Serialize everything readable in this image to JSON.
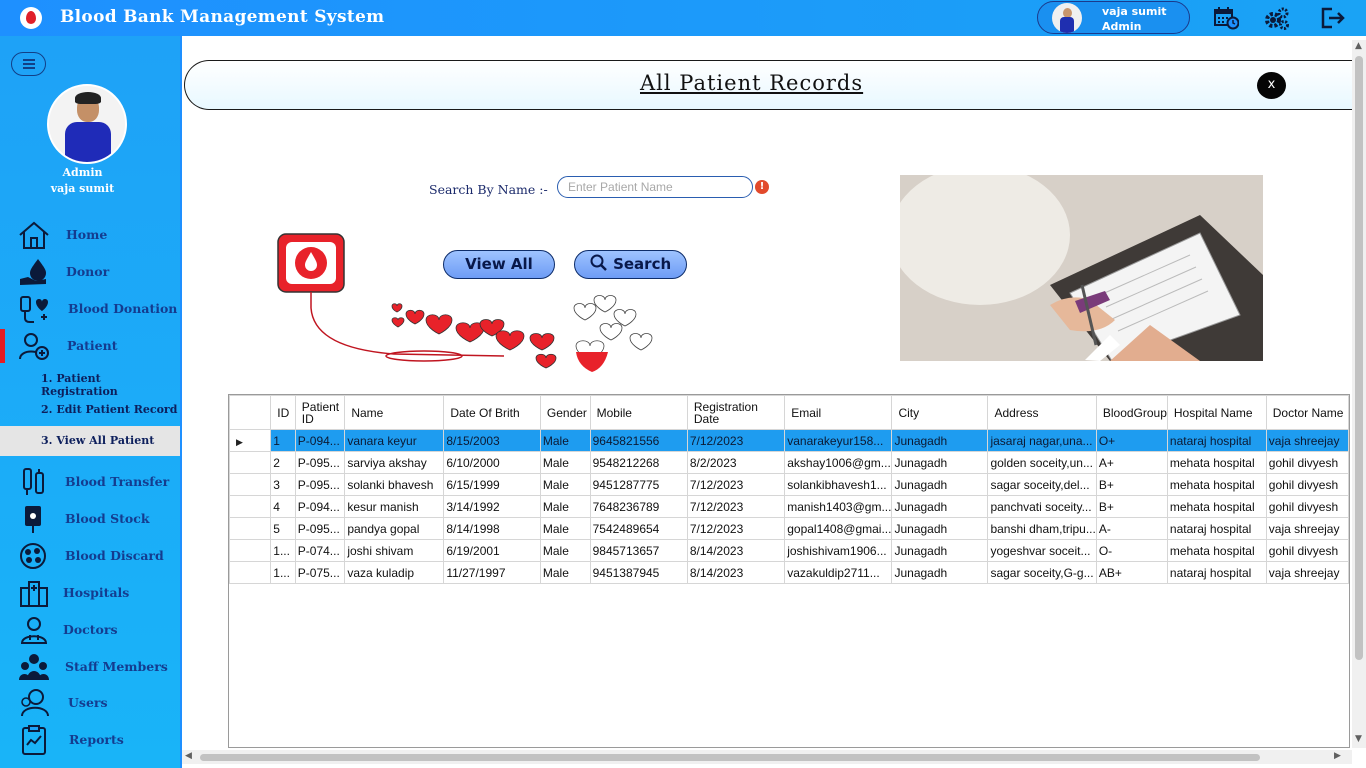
{
  "app": {
    "title": "Blood Bank Management System"
  },
  "user": {
    "name": "vaja sumit",
    "role": "Admin"
  },
  "sidebar": {
    "profile_role": "Admin",
    "profile_name": "vaja sumit",
    "items": [
      {
        "label": "Home",
        "icon": "home-icon"
      },
      {
        "label": "Donor",
        "icon": "donor-icon"
      },
      {
        "label": "Blood Donation",
        "icon": "blood-donation-icon"
      },
      {
        "label": "Patient",
        "icon": "patient-icon"
      },
      {
        "label": "Blood Transfer",
        "icon": "blood-transfer-icon"
      },
      {
        "label": "Blood Stock",
        "icon": "blood-stock-icon"
      },
      {
        "label": "Blood Discard",
        "icon": "blood-discard-icon"
      },
      {
        "label": "Hospitals",
        "icon": "hospital-icon"
      },
      {
        "label": "Doctors",
        "icon": "doctor-icon"
      },
      {
        "label": "Staff Members",
        "icon": "staff-icon"
      },
      {
        "label": "Users",
        "icon": "users-icon"
      },
      {
        "label": "Reports",
        "icon": "reports-icon"
      }
    ],
    "patient_sub": [
      "1.  Patient Registration",
      "2.  Edit Patient Record",
      "3.  View All Patient"
    ]
  },
  "page": {
    "title": "All Patient Records",
    "close_label": "x",
    "search_label": "Search By Name  :-",
    "search_placeholder": "Enter Patient Name",
    "search_value": "",
    "view_all_label": "View All",
    "search_button_label": "Search",
    "warn_glyph": "!"
  },
  "table": {
    "columns": [
      "ID",
      "Patient ID",
      "Name",
      "Date Of Brith",
      "Gender",
      "Mobile",
      "Registration Date",
      "Email",
      "City",
      "Address",
      "BloodGroup",
      "Hospital Name",
      "Doctor Name"
    ],
    "rows": [
      [
        "1",
        "P-094...",
        "vanara keyur",
        "8/15/2003",
        "Male",
        "9645821556",
        "7/12/2023",
        "vanarakeyur158...",
        "Junagadh",
        "jasaraj nagar,una...",
        "O+",
        "nataraj hospital",
        "vaja shreejay"
      ],
      [
        "2",
        "P-095...",
        "sarviya akshay",
        "6/10/2000",
        "Male",
        "9548212268",
        "8/2/2023",
        "akshay1006@gm...",
        "Junagadh",
        "golden soceity,un...",
        "A+",
        "mehata hospital",
        "gohil divyesh"
      ],
      [
        "3",
        "P-095...",
        "solanki bhavesh",
        "6/15/1999",
        "Male",
        "9451287775",
        "7/12/2023",
        "solankibhavesh1...",
        "Junagadh",
        "sagar soceity,del...",
        "B+",
        "mehata hospital",
        "gohil divyesh"
      ],
      [
        "4",
        "P-094...",
        "kesur manish",
        "3/14/1992",
        "Male",
        "7648236789",
        "7/12/2023",
        "manish1403@gm...",
        "Junagadh",
        "panchvati soceity...",
        "B+",
        "mehata hospital",
        "gohil divyesh"
      ],
      [
        "5",
        "P-095...",
        "pandya gopal",
        "8/14/1998",
        "Male",
        "7542489654",
        "7/12/2023",
        "gopal1408@gmai...",
        "Junagadh",
        "banshi dham,tripu...",
        "A-",
        "nataraj hospital",
        "vaja shreejay"
      ],
      [
        "1...",
        "P-074...",
        "joshi shivam",
        "6/19/2001",
        "Male",
        "9845713657",
        "8/14/2023",
        "joshishivam1906...",
        "Junagadh",
        "yogeshvar soceit...",
        "O-",
        "mehata hospital",
        "gohil divyesh"
      ],
      [
        "1...",
        "P-075...",
        "vaza kuladip",
        "11/27/1997",
        "Male",
        "9451387945",
        "8/14/2023",
        "vazakuldip2711...",
        "Junagadh",
        "sagar soceity,G-g...",
        "AB+",
        "nataraj hospital",
        "vaja shreejay"
      ]
    ],
    "selected_row": 0
  },
  "colors": {
    "topbar": "#1e90ff",
    "sidebar": "#1ea2f7",
    "selected_row": "#1e9cf0",
    "active_marker": "#e51c23"
  }
}
